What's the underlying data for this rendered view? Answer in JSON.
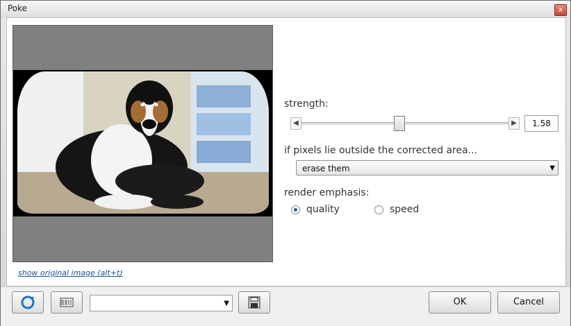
{
  "window": {
    "title": "Poke",
    "close_glyph": "x"
  },
  "preview": {
    "show_original_link": "show original image (alt+t)"
  },
  "settings": {
    "strength_label": "strength:",
    "strength_value": "1.58",
    "strength_fraction": 0.47,
    "outside_label": "if pixels lie outside the corrected area...",
    "outside_selected": "erase them",
    "render_label": "render emphasis:",
    "options": [
      {
        "label": "quality",
        "selected": true
      },
      {
        "label": "speed",
        "selected": false
      }
    ]
  },
  "footer": {
    "preset_value": "",
    "ok_label": "OK",
    "cancel_label": "Cancel"
  },
  "icons": {
    "refresh": "refresh-icon",
    "randomize": "barcode-icon",
    "save": "save-icon"
  }
}
